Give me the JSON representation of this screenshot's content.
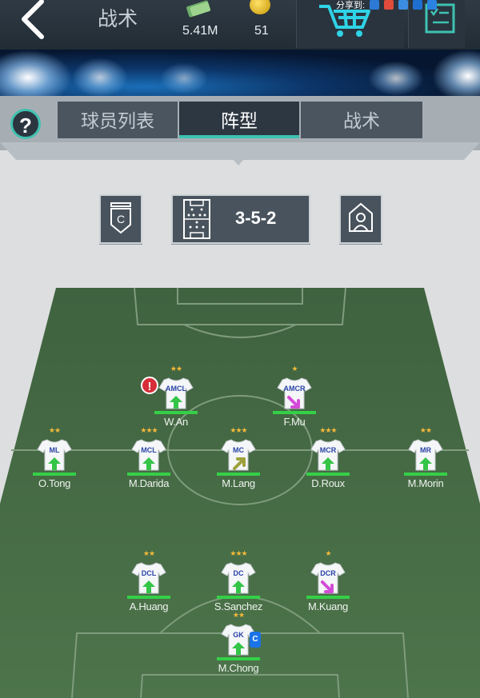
{
  "header": {
    "title": "战术",
    "money": "5.41M",
    "coins": "51",
    "share_label": "分享到:"
  },
  "tabs": [
    {
      "label": "球员列表",
      "active": false
    },
    {
      "label": "阵型",
      "active": true
    },
    {
      "label": "战术",
      "active": false
    }
  ],
  "formation": "3-5-2",
  "colors": {
    "accent": "#3fc1b0",
    "pitch": "#486f48",
    "up_arrow": "#34c447",
    "down_arrow": "#d44ad8",
    "neutral_arrow": "#9ea03c",
    "star": "#f4b93a"
  },
  "players": [
    {
      "pos": "AMCL",
      "name": "W.An",
      "stars": 2,
      "arrow": "up"
    },
    {
      "pos": "AMCR",
      "name": "F.Mu",
      "stars": 1,
      "arrow": "down"
    },
    {
      "pos": "ML",
      "name": "O.Tong",
      "stars": 2,
      "arrow": "up"
    },
    {
      "pos": "MCL",
      "name": "M.Darida",
      "stars": 3,
      "arrow": "up"
    },
    {
      "pos": "MC",
      "name": "M.Lang",
      "stars": 3,
      "arrow": "neutral"
    },
    {
      "pos": "MCR",
      "name": "D.Roux",
      "stars": 3,
      "arrow": "up"
    },
    {
      "pos": "MR",
      "name": "M.Morin",
      "stars": 2,
      "arrow": "up"
    },
    {
      "pos": "DCL",
      "name": "A.Huang",
      "stars": 2,
      "arrow": "up"
    },
    {
      "pos": "DC",
      "name": "S.Sanchez",
      "stars": 3,
      "arrow": "up"
    },
    {
      "pos": "DCR",
      "name": "M.Kuang",
      "stars": 1,
      "arrow": "down"
    },
    {
      "pos": "GK",
      "name": "M.Chong",
      "stars": 2,
      "arrow": "up"
    }
  ],
  "alert_mark": "!",
  "captain_mark": "C",
  "captain_icon": "C"
}
